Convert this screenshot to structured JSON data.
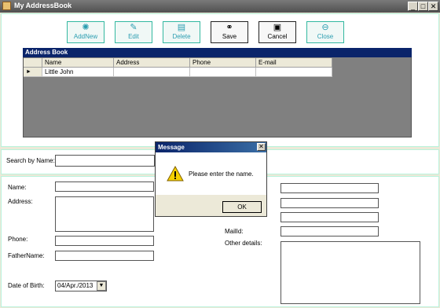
{
  "window": {
    "title": "My AddressBook",
    "minimize": "_",
    "maximize": "□",
    "close": "✕"
  },
  "toolbar": {
    "addnew_label": "AddNew",
    "edit_label": "Edit",
    "delete_label": "Delete",
    "save_label": "Save",
    "cancel_label": "Cancel",
    "close_label": "Close"
  },
  "grid": {
    "title": "Address Book",
    "columns": [
      "Name",
      "Address",
      "Phone",
      "E-mail"
    ],
    "rows": [
      {
        "indicator": "►",
        "name": "Little John",
        "address": "",
        "phone": "",
        "email": ""
      }
    ]
  },
  "search": {
    "label": "Search by Name:",
    "value": ""
  },
  "form": {
    "name_label": "Name:",
    "address_label": "Address:",
    "phone_label": "Phone:",
    "fathername_label": "FatherName:",
    "dob_label": "Date of Birth:",
    "dob_value": "04/Apr./2013",
    "mailid_label": "MailId:",
    "other_details_label": "Other details:"
  },
  "dialog": {
    "title": "Message",
    "message": "Please enter the name.",
    "ok_label": "OK",
    "close": "✕",
    "icon": "warning-icon"
  }
}
